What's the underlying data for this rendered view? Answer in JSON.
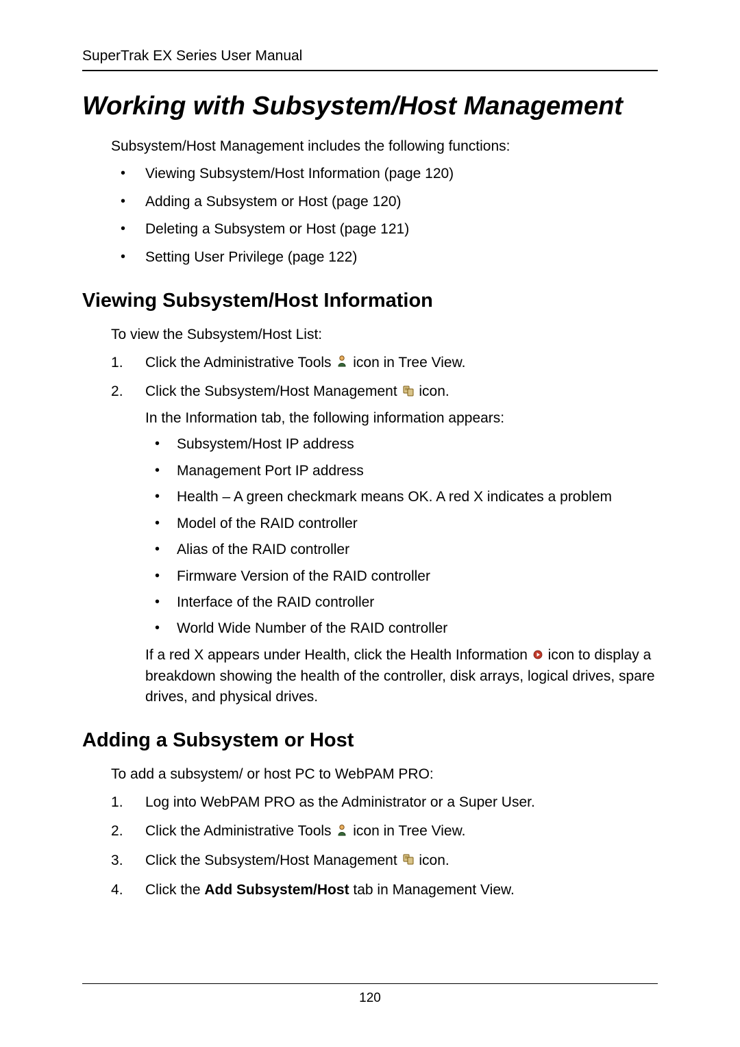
{
  "header": {
    "manual_title": "SuperTrak EX Series User Manual"
  },
  "main_heading": "Working with Subsystem/Host Management",
  "intro_text": "Subsystem/Host Management includes the following functions:",
  "intro_bullets": [
    "Viewing Subsystem/Host Information (page 120)",
    "Adding a Subsystem or Host (page 120)",
    "Deleting a Subsystem or Host (page 121)",
    "Setting User Privilege (page 122)"
  ],
  "section1": {
    "heading": "Viewing Subsystem/Host Information",
    "lead": "To view the Subsystem/Host List:",
    "step1_pre": "Click the Administrative Tools ",
    "step1_post": " icon in Tree View.",
    "step2_pre": "Click the Subsystem/Host Management ",
    "step2_post": " icon.",
    "step2_info": "In the Information tab, the following information appears:",
    "info_bullets": [
      "Subsystem/Host IP address",
      "Management Port IP address",
      "Health – A green checkmark means OK. A red X indicates a problem",
      "Model of the RAID controller",
      "Alias of the RAID controller",
      "Firmware Version of the RAID controller",
      "Interface of the RAID controller",
      "World Wide Number of the RAID controller"
    ],
    "tail_pre": "If a red X appears under Health, click the Health Information ",
    "tail_post": " icon to display a breakdown showing the health of the controller, disk arrays, logical drives, spare drives, and physical drives."
  },
  "section2": {
    "heading": "Adding a Subsystem or Host",
    "lead": "To add a subsystem/ or host PC to WebPAM PRO:",
    "step1": "Log into WebPAM PRO as the Administrator or a Super User.",
    "step2_pre": "Click the Administrative Tools ",
    "step2_post": " icon in Tree View.",
    "step3_pre": "Click the Subsystem/Host Management ",
    "step3_post": " icon.",
    "step4_pre": "Click the ",
    "step4_bold": "Add Subsystem/Host",
    "step4_post": " tab in Management View."
  },
  "footer": {
    "page_number": "120"
  }
}
